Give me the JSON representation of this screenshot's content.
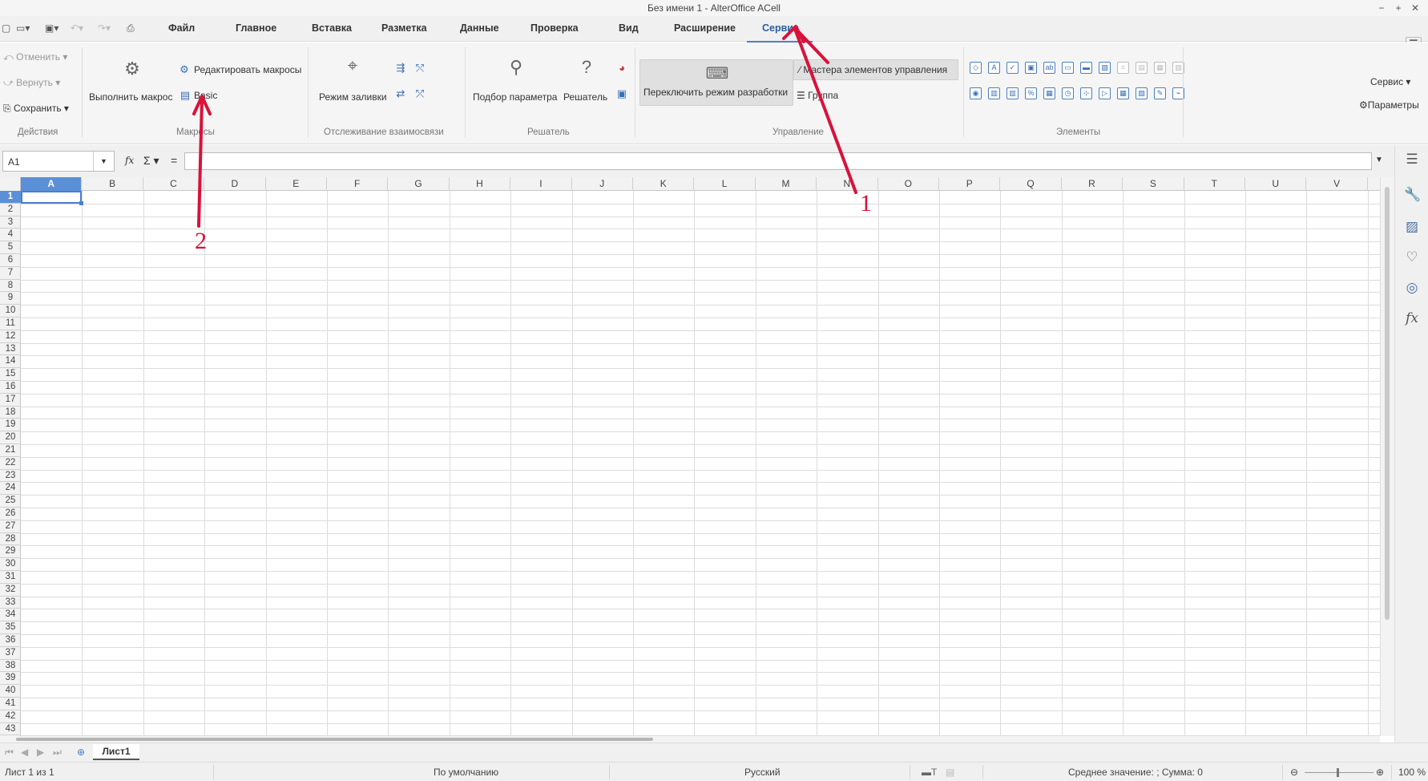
{
  "window": {
    "title": "Без имени 1 - AlterOffice ACell",
    "minimize": "−",
    "maximize": "+",
    "close": "✕"
  },
  "quick_access": {
    "icons": [
      "new-doc-icon",
      "open-icon",
      "save-icon",
      "undo-icon",
      "redo-icon",
      "print-icon"
    ]
  },
  "menu_tabs": [
    {
      "label": "Файл",
      "active": false
    },
    {
      "label": "Главное",
      "active": false
    },
    {
      "label": "Вставка",
      "active": false
    },
    {
      "label": "Разметка",
      "active": false
    },
    {
      "label": "Данные",
      "active": false
    },
    {
      "label": "Проверка",
      "active": false
    },
    {
      "label": "Вид",
      "active": false
    },
    {
      "label": "Расширение",
      "active": false
    },
    {
      "label": "Сервис",
      "active": true
    }
  ],
  "ribbon": {
    "actions": {
      "undo": "Отменить",
      "redo": "Вернуть",
      "save": "Сохранить",
      "group": "Действия"
    },
    "macros": {
      "run": "Выполнить макрос",
      "edit": "Редактировать макросы",
      "basic": "Basic",
      "group": "Макросы"
    },
    "trace": {
      "fill_mode": "Режим заливки",
      "group": "Отслеживание взаимосвязи"
    },
    "solver": {
      "goal_seek": "Подбор параметра",
      "solver": "Решатель",
      "group": "Решатель"
    },
    "controls": {
      "design_mode": "Переключить режим разработки",
      "wizards": "Мастера элементов управления",
      "group_btn": "Группа",
      "group": "Управление"
    },
    "elements": {
      "group": "Элементы"
    },
    "service": {
      "dropdown": "Сервис",
      "params": "Параметры"
    }
  },
  "formula_bar": {
    "cell_ref": "A1",
    "fx": "fx",
    "sigma": "Σ",
    "equals": "=",
    "value": ""
  },
  "grid": {
    "columns": [
      "A",
      "B",
      "C",
      "D",
      "E",
      "F",
      "G",
      "H",
      "I",
      "J",
      "K",
      "L",
      "M",
      "N",
      "O",
      "P",
      "Q",
      "R",
      "S",
      "T",
      "U",
      "V"
    ],
    "rows": [
      "1",
      "2",
      "3",
      "4",
      "5",
      "6",
      "7",
      "8",
      "9",
      "10",
      "11",
      "12",
      "13",
      "14",
      "15",
      "16",
      "17",
      "18",
      "19",
      "20",
      "21",
      "22",
      "23",
      "24",
      "25",
      "26",
      "27",
      "28",
      "29",
      "30",
      "31",
      "32",
      "33",
      "34",
      "35",
      "36",
      "37",
      "38",
      "39",
      "40",
      "41",
      "42",
      "43"
    ],
    "selected_cell": "A1"
  },
  "sheets": {
    "active": "Лист1"
  },
  "status": {
    "sheet_info": "Лист 1 из 1",
    "style": "По умолчанию",
    "language": "Русский",
    "stats": "Среднее значение: ; Сумма: 0",
    "zoom": "100 %"
  },
  "annotations": {
    "arrow1_label": "1",
    "arrow2_label": "2",
    "color": "#d8123b"
  }
}
